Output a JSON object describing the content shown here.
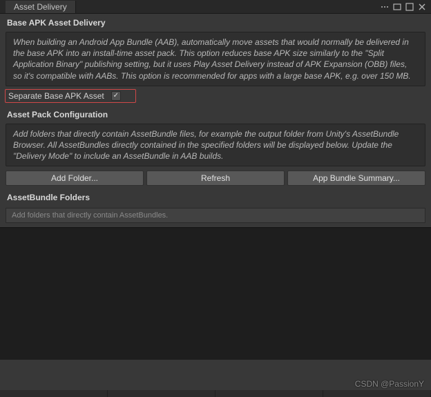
{
  "titlebar": {
    "tab_label": "Asset Delivery"
  },
  "base_apk": {
    "header": "Base APK Asset Delivery",
    "help": "When building an Android App Bundle (AAB), automatically move assets that would normally be delivered in the base APK into an install-time asset pack. This option reduces base APK size similarly to the \"Split Application Binary\" publishing setting, but it uses Play Asset Delivery instead of APK Expansion (OBB) files, so it's compatible with AABs. This option is recommended for apps with a large base APK, e.g. over 150 MB.",
    "checkbox_label": "Separate Base APK Asset",
    "checkbox_checked": true
  },
  "asset_pack": {
    "header": "Asset Pack Configuration",
    "help": "Add folders that directly contain AssetBundle files, for example the output folder from Unity's AssetBundle Browser. All AssetBundles directly contained in the specified folders will be displayed below. Update the \"Delivery Mode\" to include an AssetBundle in AAB builds.",
    "buttons": {
      "add_folder": "Add Folder...",
      "refresh": "Refresh",
      "summary": "App Bundle Summary..."
    }
  },
  "folders": {
    "header": "AssetBundle Folders",
    "hint": "Add folders that directly contain AssetBundles."
  },
  "watermark": "CSDN @PassionY"
}
